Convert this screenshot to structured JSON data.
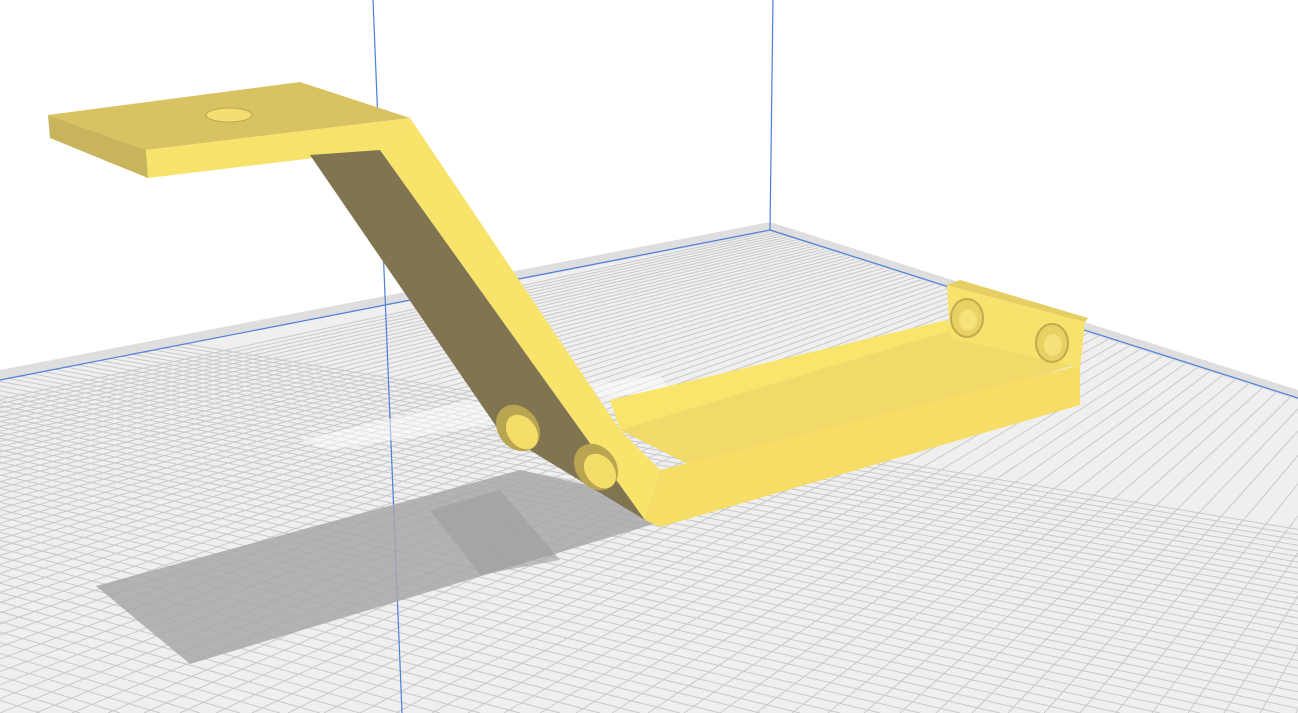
{
  "app": {
    "view": "3d-build-plate-viewport"
  },
  "scene": {
    "model": {
      "name": "",
      "part": "z-shaped-bracket",
      "color": "#f7de6a",
      "color_shade": "#c9b458",
      "color_dark": "#7d734f",
      "hole_count": 5
    },
    "build_plate": {
      "grid_color": "#c9c9c9",
      "plate_color": "#f0f0f0",
      "edge_color": "#cdcdcd"
    },
    "axes": {
      "vertical_line_color": "#4d7fd9",
      "boundary_color": "#4d7fd9"
    },
    "shadow_color": "#a7a7a7",
    "background_color": "#ffffff"
  }
}
